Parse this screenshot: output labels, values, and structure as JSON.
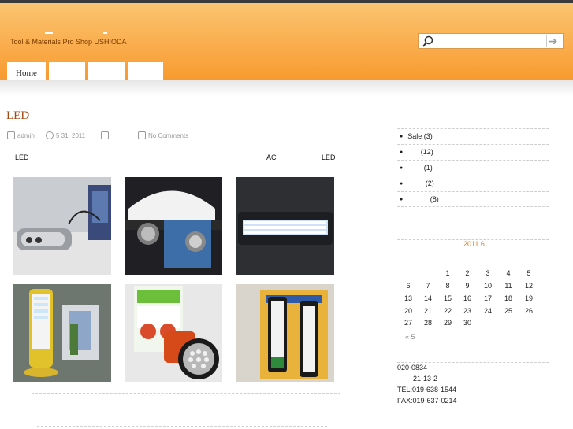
{
  "site": {
    "tagline": "Tool & Materials Pro Shop USHIODA"
  },
  "search": {
    "placeholder": "",
    "submit_glyph": "➔"
  },
  "nav": {
    "tabs": [
      "Home",
      "",
      "",
      ""
    ]
  },
  "post": {
    "title": "LED",
    "author": "admin",
    "date": "5  31, 2011",
    "comments": "No Comments",
    "text_left": "LED",
    "text_mid": "AC",
    "text_right": "LED"
  },
  "sidebar": {
    "categories": [
      {
        "label": "Sale",
        "count": "(3)"
      },
      {
        "label": "",
        "count": "(12)"
      },
      {
        "label": "",
        "count": "(1)"
      },
      {
        "label": "",
        "count": "(2)"
      },
      {
        "label": "",
        "count": "(8)"
      }
    ],
    "calendar": {
      "title": "2011 6",
      "weeks": [
        [
          "",
          "",
          "1",
          "2",
          "3",
          "4",
          "5"
        ],
        [
          "6",
          "7",
          "8",
          "9",
          "10",
          "11",
          "12"
        ],
        [
          "13",
          "14",
          "15",
          "16",
          "17",
          "18",
          "19"
        ],
        [
          "20",
          "21",
          "22",
          "23",
          "24",
          "25",
          "26"
        ],
        [
          "27",
          "28",
          "29",
          "30",
          "",
          "",
          ""
        ]
      ],
      "prev_link": "« 5"
    },
    "address": {
      "postal": "020-0834",
      "street": "21-13-2",
      "tel": "TEL:019-638-1544",
      "fax": "FAX:019-637-0214"
    }
  }
}
